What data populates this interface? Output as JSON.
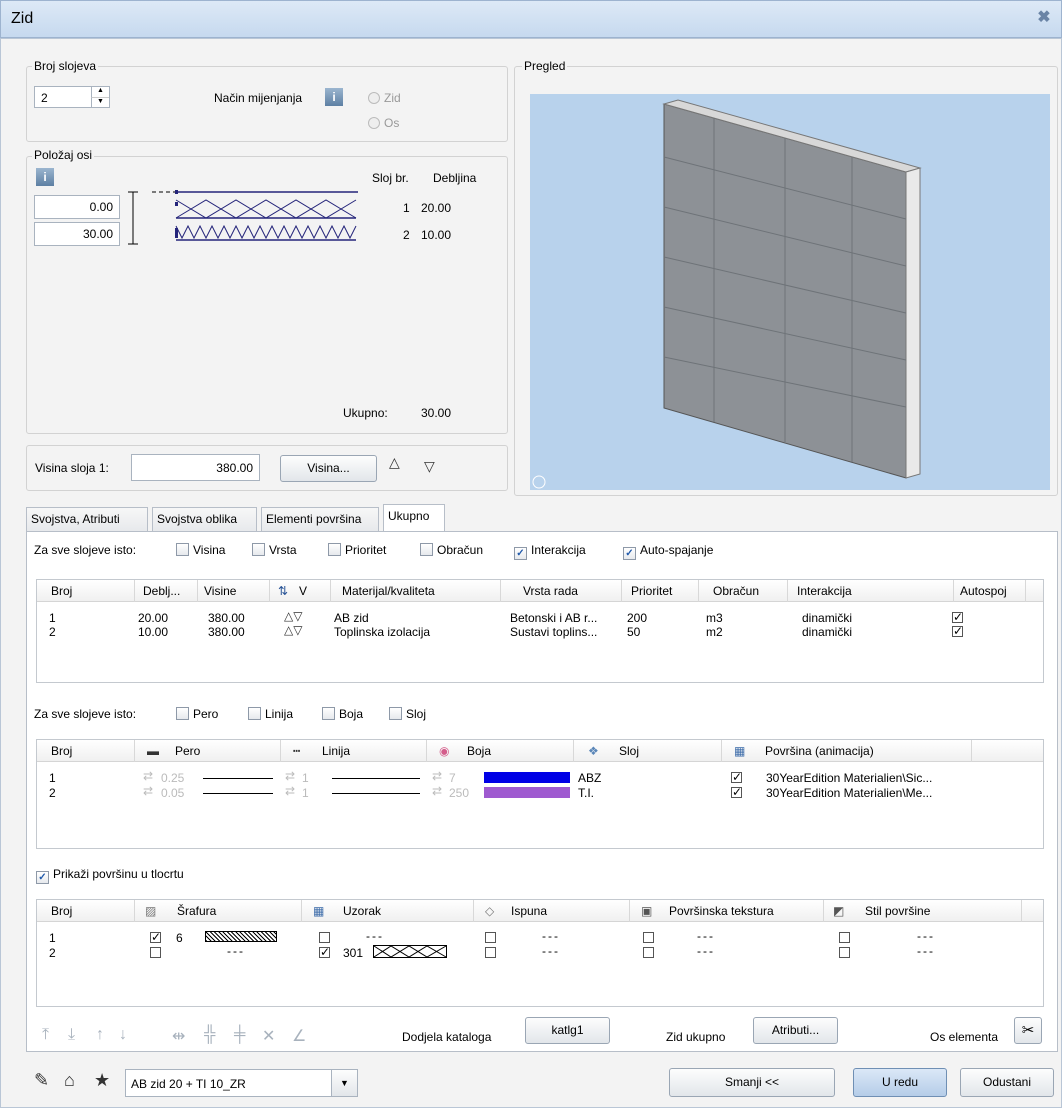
{
  "window": {
    "title": "Zid"
  },
  "layers_group": {
    "label": "Broj slojeva",
    "count": "2",
    "mode_label": "Način mijenjanja",
    "radio_zid": "Zid",
    "radio_os": "Os"
  },
  "axis_group": {
    "label": "Položaj osi",
    "values": [
      "0.00",
      "30.00"
    ],
    "col_layer": "Sloj br.",
    "col_thickness": "Debljina",
    "rows": [
      {
        "n": "1",
        "d": "20.00"
      },
      {
        "n": "2",
        "d": "10.00"
      }
    ],
    "total_label": "Ukupno:",
    "total_value": "30.00"
  },
  "height": {
    "label": "Visina sloja 1:",
    "value": "380.00",
    "button": "Visina..."
  },
  "preview": {
    "label": "Pregled"
  },
  "tabs": [
    "Svojstva, Atributi",
    "Svojstva oblika",
    "Elementi površina",
    "Ukupno"
  ],
  "same1": {
    "label": "Za sve slojeve isto:",
    "items": [
      {
        "t": "Visina",
        "c": false
      },
      {
        "t": "Vrsta",
        "c": false
      },
      {
        "t": "Prioritet",
        "c": false
      },
      {
        "t": "Obračun",
        "c": false
      },
      {
        "t": "Interakcija",
        "c": true
      },
      {
        "t": "Auto-spajanje",
        "c": true
      }
    ]
  },
  "table1": {
    "headers": [
      "Broj",
      "Deblj...",
      "Visine",
      "V",
      "Materijal/kvaliteta",
      "Vrsta rada",
      "Prioritet",
      "Obračun",
      "Interakcija",
      "Autospoj"
    ],
    "rows": [
      [
        "1",
        "20.00",
        "380.00",
        "AB zid",
        "Betonski i AB r...",
        "200",
        "m3",
        "dinamički"
      ],
      [
        "2",
        "10.00",
        "380.00",
        "Toplinska izolacija",
        "Sustavi toplins...",
        "50",
        "m2",
        "dinamički"
      ]
    ]
  },
  "same2": {
    "label": "Za sve slojeve isto:",
    "items": [
      "Pero",
      "Linija",
      "Boja",
      "Sloj"
    ]
  },
  "table2": {
    "headers": [
      "Broj",
      "Pero",
      "Linija",
      "Boja",
      "Sloj",
      "Površina (animacija)"
    ],
    "rows": [
      {
        "n": "1",
        "pen": "0.25",
        "line": "1",
        "color_num": "7",
        "color": "#0000e6",
        "layer": "ABZ",
        "surface": "30YearEdition Materialien\\Sic..."
      },
      {
        "n": "2",
        "pen": "0.05",
        "line": "1",
        "color_num": "250",
        "color": "#9f5ad0",
        "layer": "T.I.",
        "surface": "30YearEdition Materialien\\Me..."
      }
    ]
  },
  "show_surface": {
    "label": "Prikaži površinu u tlocrtu",
    "checked": true
  },
  "table3": {
    "headers": [
      "Broj",
      "Šrafura",
      "Uzorak",
      "Ispuna",
      "Površinska tekstura",
      "Stil površine"
    ],
    "rows": [
      {
        "n": "1",
        "hatch": "6",
        "pattern": "---",
        "fill": "---",
        "tex": "---",
        "style": "---"
      },
      {
        "n": "2",
        "hatch": "---",
        "pattern": "301",
        "fill": "---",
        "tex": "---",
        "style": "---"
      }
    ]
  },
  "bottom": {
    "catalog_label": "Dodjela kataloga",
    "catalog_btn": "katlg1",
    "total_label": "Zid ukupno",
    "attr_btn": "Atributi...",
    "axis_label": "Os elementa"
  },
  "footer": {
    "favorite": "AB zid 20 + TI 10_ZR",
    "smanji": "Smanji <<",
    "ok": "U redu",
    "cancel": "Odustani"
  }
}
